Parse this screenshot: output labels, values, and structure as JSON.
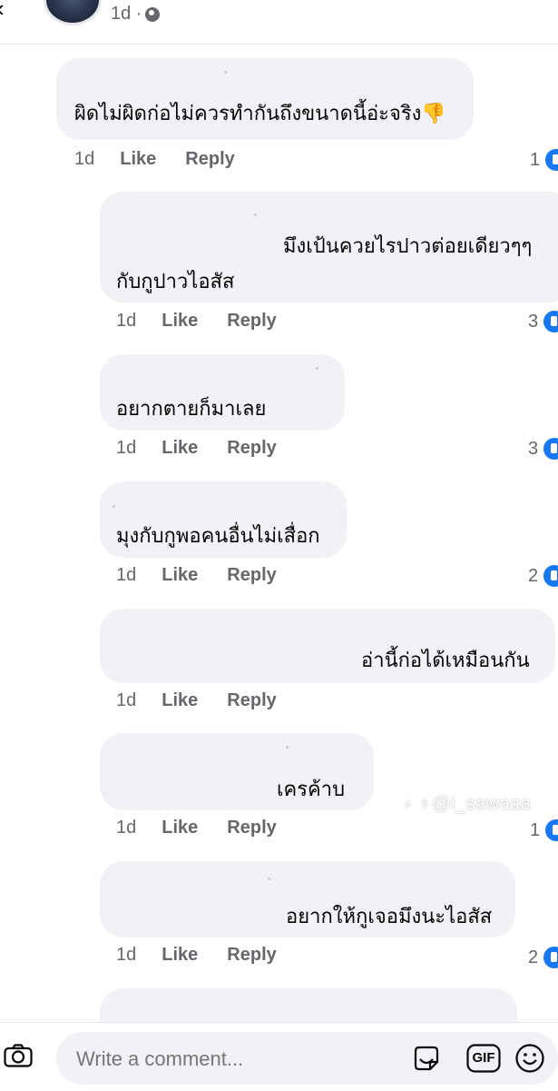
{
  "post": {
    "time": "1d ·"
  },
  "comments": [
    {
      "text": "ผิดไม่ผิดก่อไม่ควรทำกันถึงขนาดนี้อ่ะจริง👎",
      "time": "1d",
      "like": "Like",
      "reply": "Reply",
      "reactions": "1"
    },
    {
      "text_line1": "มึงเป้นควยไรปาวต่อยเดียวๆๆ",
      "text_line2": "กับกูปาวไอสัส",
      "time": "1d",
      "like": "Like",
      "reply": "Reply",
      "reactions": "3"
    },
    {
      "text": "อยากตายก็มาเลย",
      "time": "1d",
      "like": "Like",
      "reply": "Reply",
      "reactions": "3"
    },
    {
      "text": "มุงกับกูพอคนอื่นไม่เสื่อก",
      "time": "1d",
      "like": "Like",
      "reply": "Reply",
      "reactions": "2"
    },
    {
      "text": "อ่านี้ก่อได้เหมือนกัน",
      "time": "1d",
      "like": "Like",
      "reply": "Reply"
    },
    {
      "text": "เครค้าบ",
      "time": "1d",
      "like": "Like",
      "reply": "Reply",
      "reactions": "1"
    },
    {
      "text": "อยากให้กูเจอมึงนะไอสัส",
      "time": "1d",
      "like": "Like",
      "reply": "Reply",
      "reactions": "2"
    }
  ],
  "watermark": "♪ ♀@i_sawaaa",
  "composer": {
    "placeholder": "Write a comment...",
    "gif_label": "GIF"
  },
  "icons": {
    "camera": "camera-icon",
    "sticker": "sticker-icon",
    "gif": "gif-icon",
    "emoji": "emoji-icon",
    "like": "like-icon",
    "globe": "globe-icon",
    "back": "back-arrow-icon"
  },
  "colors": {
    "accent": "#1877f2",
    "bubble": "#f0f2f5",
    "muted": "#65676b"
  }
}
